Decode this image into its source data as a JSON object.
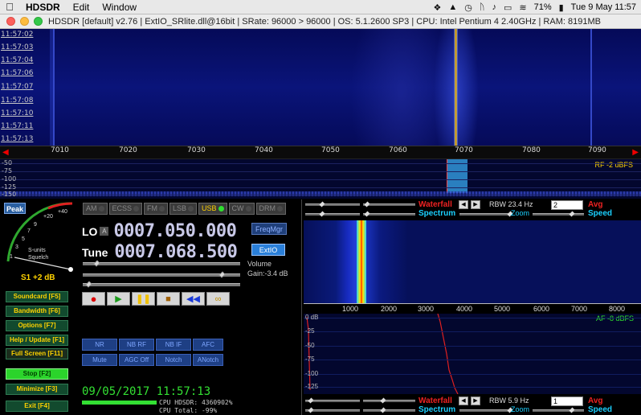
{
  "menubar": {
    "app": "HDSDR",
    "items": [
      "Edit",
      "Window"
    ],
    "battery": "71%",
    "clock": "Tue 9 May  11:57"
  },
  "titlebar": {
    "text": "HDSDR  [default]   v2.76   |   ExtIO_SRlite.dll@16bit   |   SRate: 96000 > 96000   |   OS: 5.1.2600 SP3   |   CPU: Intel Pentium 4 2.40GHz   |   RAM: 8191MB"
  },
  "waterfall": {
    "times": [
      "11:57:02",
      "11:57:03",
      "11:57:04",
      "11:57:06",
      "11:57:07",
      "11:57:08",
      "11:57:10",
      "11:57:11",
      "11:57:13"
    ]
  },
  "freq_scale": {
    "ticks": [
      "7010",
      "7020",
      "7030",
      "7040",
      "7050",
      "7060",
      "7070",
      "7080",
      "7090"
    ]
  },
  "rf_spectrum": {
    "db_labels": [
      "-50",
      "-75",
      "-100",
      "-125",
      "-150"
    ],
    "rf_label": "RF -2 dBFS"
  },
  "smeter": {
    "peak_label": "Peak",
    "scale": [
      "1",
      "3",
      "5",
      "7",
      "9",
      "+20",
      "+40"
    ],
    "caption1": "S-units",
    "caption2": "Squelch",
    "reading": "S1 +2 dB"
  },
  "modes": [
    {
      "label": "AM",
      "on": false
    },
    {
      "label": "ECSS",
      "on": false
    },
    {
      "label": "FM",
      "on": false
    },
    {
      "label": "LSB",
      "on": false
    },
    {
      "label": "USB",
      "on": true
    },
    {
      "label": "CW",
      "on": false
    },
    {
      "label": "DRM",
      "on": false
    }
  ],
  "lo": {
    "label": "LO",
    "badge": "A",
    "value": "0007.050.000"
  },
  "tune": {
    "label": "Tune",
    "value": "0007.068.500"
  },
  "buttons": {
    "freqmgr": "FreqMgr",
    "extio": "ExtIO",
    "volume": "Volume",
    "gain": "Gain:-3.4 dB"
  },
  "sidebar": [
    {
      "label": "Soundcard  [F5]"
    },
    {
      "label": "Bandwidth  [F6]"
    },
    {
      "label": "Options    [F7]"
    },
    {
      "label": "Help / Update  [F1]"
    },
    {
      "label": "Full Screen  [F11]"
    },
    {
      "label": "Stop       [F2]"
    },
    {
      "label": "Minimize  [F3]"
    },
    {
      "label": "Exit       [F4]"
    }
  ],
  "dsp_row1": [
    "NR",
    "NB RF",
    "NB IF",
    "AFC"
  ],
  "dsp_row2": [
    "Mute",
    "AGC Off",
    "Notch",
    "ANotch"
  ],
  "clock": "09/05/2017 11:57:13",
  "cpu": {
    "hdsdr": "CPU HDSDR: 4360902%",
    "total": "CPU Total:  -99%"
  },
  "rf_controls": {
    "waterfall": "Waterfall",
    "spectrum": "Spectrum",
    "rbw": "RBW 23.4 Hz",
    "zoom": "Zoom",
    "avg_value": "2",
    "avg": "Avg",
    "speed": "Speed"
  },
  "af_controls": {
    "waterfall": "Waterfall",
    "spectrum": "Spectrum",
    "rbw": "RBW   5.9 Hz",
    "zoom": "Zoom",
    "avg_value": "1",
    "avg": "Avg",
    "speed": "Speed"
  },
  "af_scale": [
    "1000",
    "2000",
    "3000",
    "4000",
    "5000",
    "6000",
    "7000",
    "8000"
  ],
  "af_spectrum": {
    "db_labels": [
      "0 dB",
      "-25",
      "-50",
      "-75",
      "-100",
      "-125"
    ],
    "af_label": "AF -8 dBFS"
  },
  "colors": {
    "accent_yellow": "#ffd200",
    "waterfall_red": "#e22222",
    "spectrum_cyan": "#1bd0ff",
    "stop_green": "#2bd42b"
  }
}
